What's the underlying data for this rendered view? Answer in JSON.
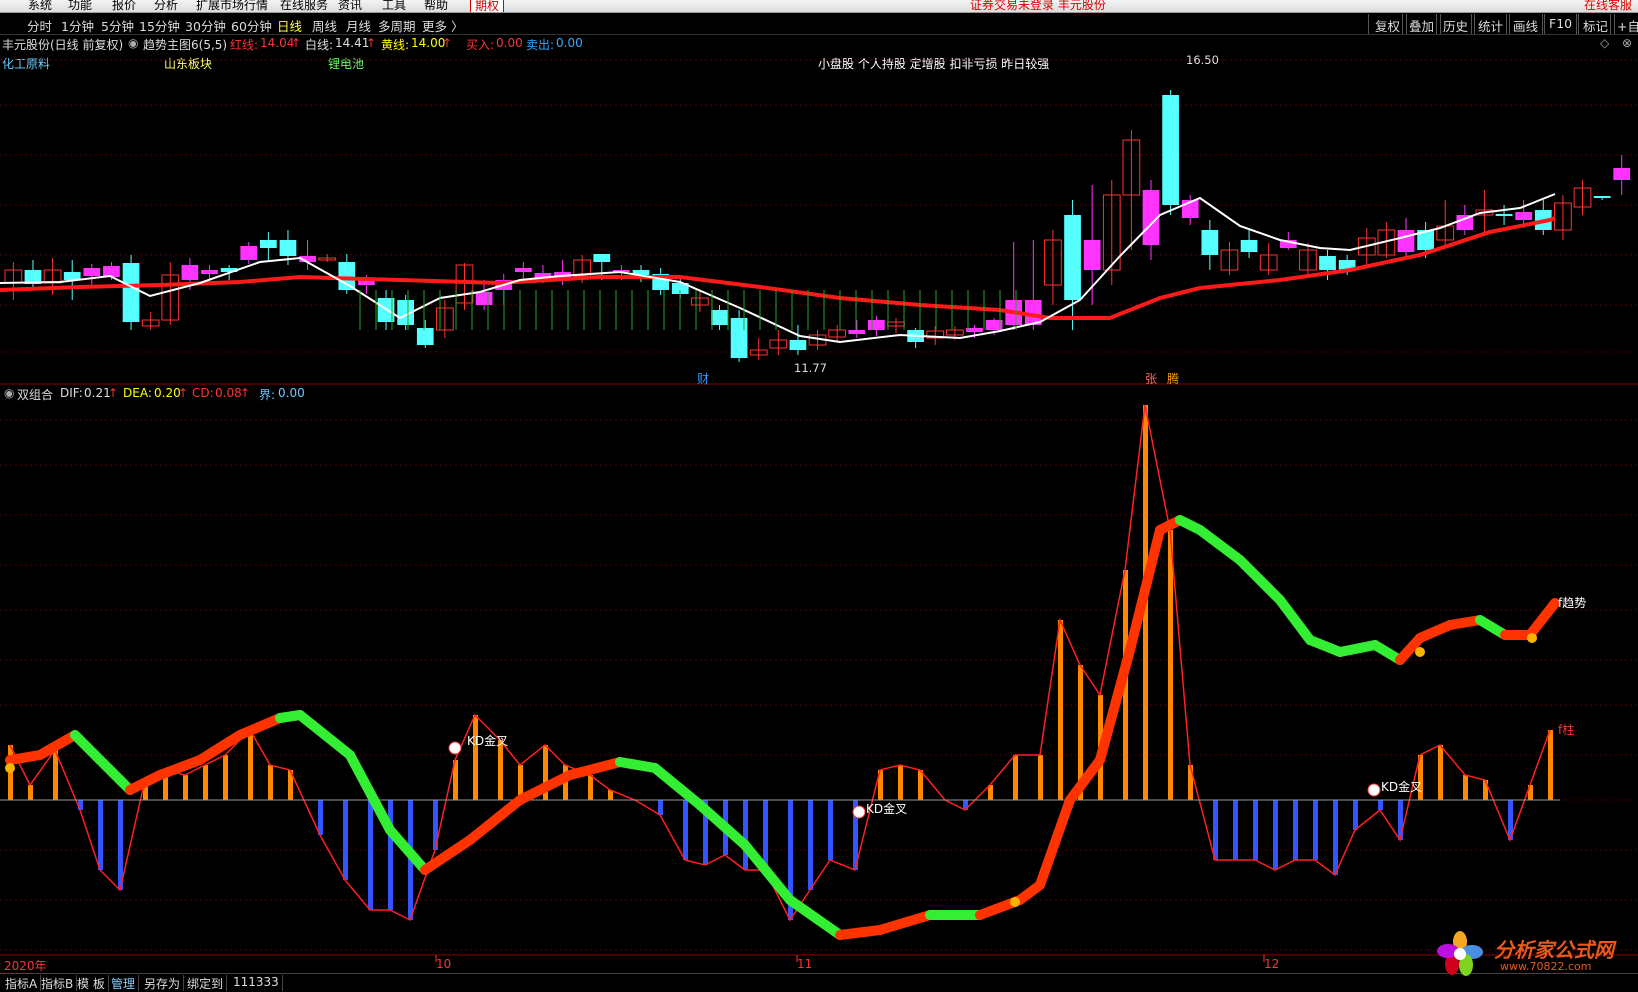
{
  "menu": {
    "items": [
      "系统",
      "功能",
      "报价",
      "分析",
      "扩展市场行情",
      "在线服务",
      "资讯",
      "工具",
      "帮助"
    ],
    "period_tag": "期权",
    "status_text": "证券交易未登录  丰元股份",
    "right_text": "在线客服"
  },
  "periods": {
    "items": [
      "分时",
      "1分钟",
      "5分钟",
      "15分钟",
      "30分钟",
      "60分钟",
      "日线",
      "周线",
      "月线",
      "多周期",
      "更多 〉"
    ],
    "active": "日线"
  },
  "toolbar": {
    "items": [
      "复权",
      "叠加",
      "历史",
      "统计",
      "画线",
      "F10",
      "标记",
      "+自"
    ]
  },
  "kline": {
    "stock": "丰元股份(日线 前复权)",
    "indicator": "趋势主图6(5,5)",
    "red_label": "红线:",
    "red_value": "14.04",
    "white_label": "白线:",
    "white_value": "14.41",
    "yellow_label": "黄线:",
    "yellow_value": "14.00",
    "buy_label": "买入:",
    "buy_value": "0.00",
    "sell_label": "卖出:",
    "sell_value": "0.00",
    "arrow": "↑",
    "sectors": [
      "化工原料",
      "山东板块",
      "锂电池"
    ],
    "desc": "小盘股 个人持股 定增股 扣非亏损 昨日较强",
    "high": "16.50",
    "low": "11.77",
    "events": {
      "cai": "财",
      "zhang": "张",
      "teng": "腾"
    }
  },
  "macd": {
    "name": "双组合",
    "dif_label": "DIF:",
    "dif_value": "0.21",
    "dea_label": "DEA:",
    "dea_value": "0.20",
    "cd_label": "CD:",
    "cd_value": "0.08",
    "jie_label": "界:",
    "jie_value": "0.00",
    "labels": {
      "kd": "KD金叉",
      "trend": "f趋势",
      "zhu": "f柱"
    }
  },
  "timeaxis": {
    "labels": [
      "2020年",
      "10",
      "11",
      "12"
    ]
  },
  "bottom": {
    "tabs": [
      "指标A",
      "指标B",
      "模 板",
      "管理",
      "另存为",
      "绑定到",
      "111333"
    ]
  },
  "watermark": {
    "text": "分析家公式网",
    "url": "www.70822.com"
  },
  "colors": {
    "up": "#ff3333",
    "down": "#55ffff",
    "pink": "#ff33ff",
    "red_line": "#ff1a1a",
    "white_line": "#ffffff"
  }
}
